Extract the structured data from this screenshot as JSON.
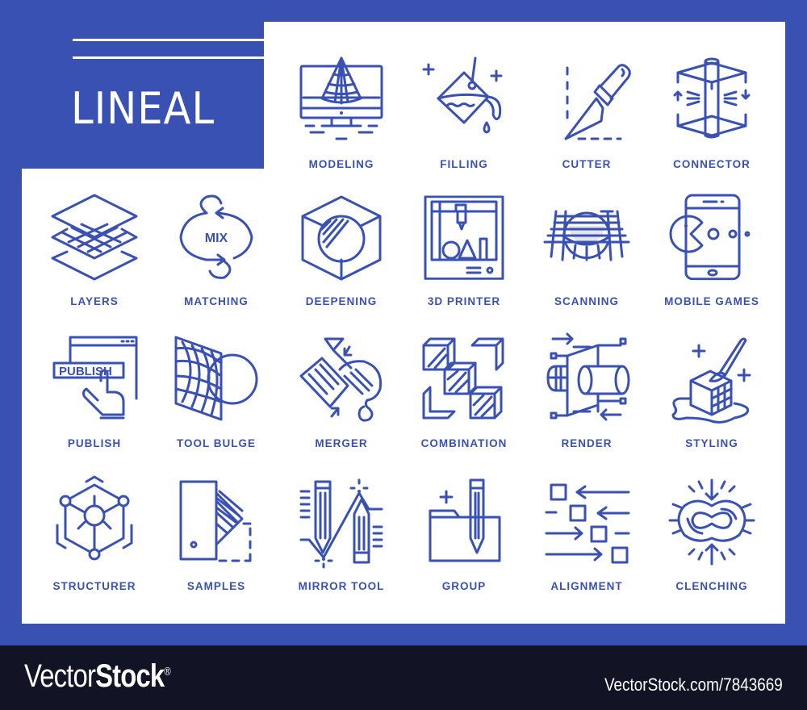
{
  "header": {
    "title": "LINEAL"
  },
  "colors": {
    "accent": "#3a51b4",
    "panel": "#ffffff",
    "footer": "#121426"
  },
  "icons": [
    {
      "label": "MODELING",
      "icon": "modeling-icon"
    },
    {
      "label": "FILLING",
      "icon": "filling-icon"
    },
    {
      "label": "CUTTER",
      "icon": "cutter-icon"
    },
    {
      "label": "CONNECTOR",
      "icon": "connector-icon"
    },
    {
      "label": "LAYERS",
      "icon": "layers-icon"
    },
    {
      "label": "MATCHING",
      "icon": "matching-icon",
      "text": "MIX"
    },
    {
      "label": "DEEPENING",
      "icon": "deepening-icon"
    },
    {
      "label": "3D PRINTER",
      "icon": "3d-printer-icon"
    },
    {
      "label": "SCANNING",
      "icon": "scanning-icon"
    },
    {
      "label": "MOBILE GAMES",
      "icon": "mobile-games-icon"
    },
    {
      "label": "PUBLISH",
      "icon": "publish-icon",
      "text": "PUBLISH"
    },
    {
      "label": "TOOL BULGE",
      "icon": "tool-bulge-icon"
    },
    {
      "label": "MERGER",
      "icon": "merger-icon"
    },
    {
      "label": "COMBINATION",
      "icon": "combination-icon"
    },
    {
      "label": "RENDER",
      "icon": "render-icon"
    },
    {
      "label": "STYLING",
      "icon": "styling-icon"
    },
    {
      "label": "STRUCTURER",
      "icon": "structurer-icon"
    },
    {
      "label": "SAMPLES",
      "icon": "samples-icon"
    },
    {
      "label": "MIRROR TOOL",
      "icon": "mirror-tool-icon"
    },
    {
      "label": "GROUP",
      "icon": "group-icon"
    },
    {
      "label": "ALIGNMENT",
      "icon": "alignment-icon"
    },
    {
      "label": "CLENCHING",
      "icon": "clenching-icon"
    }
  ],
  "footer": {
    "brand_light": "Vector",
    "brand_bold": "Stock",
    "brand_mark": "®",
    "url": "VectorStock.com/7843669"
  }
}
